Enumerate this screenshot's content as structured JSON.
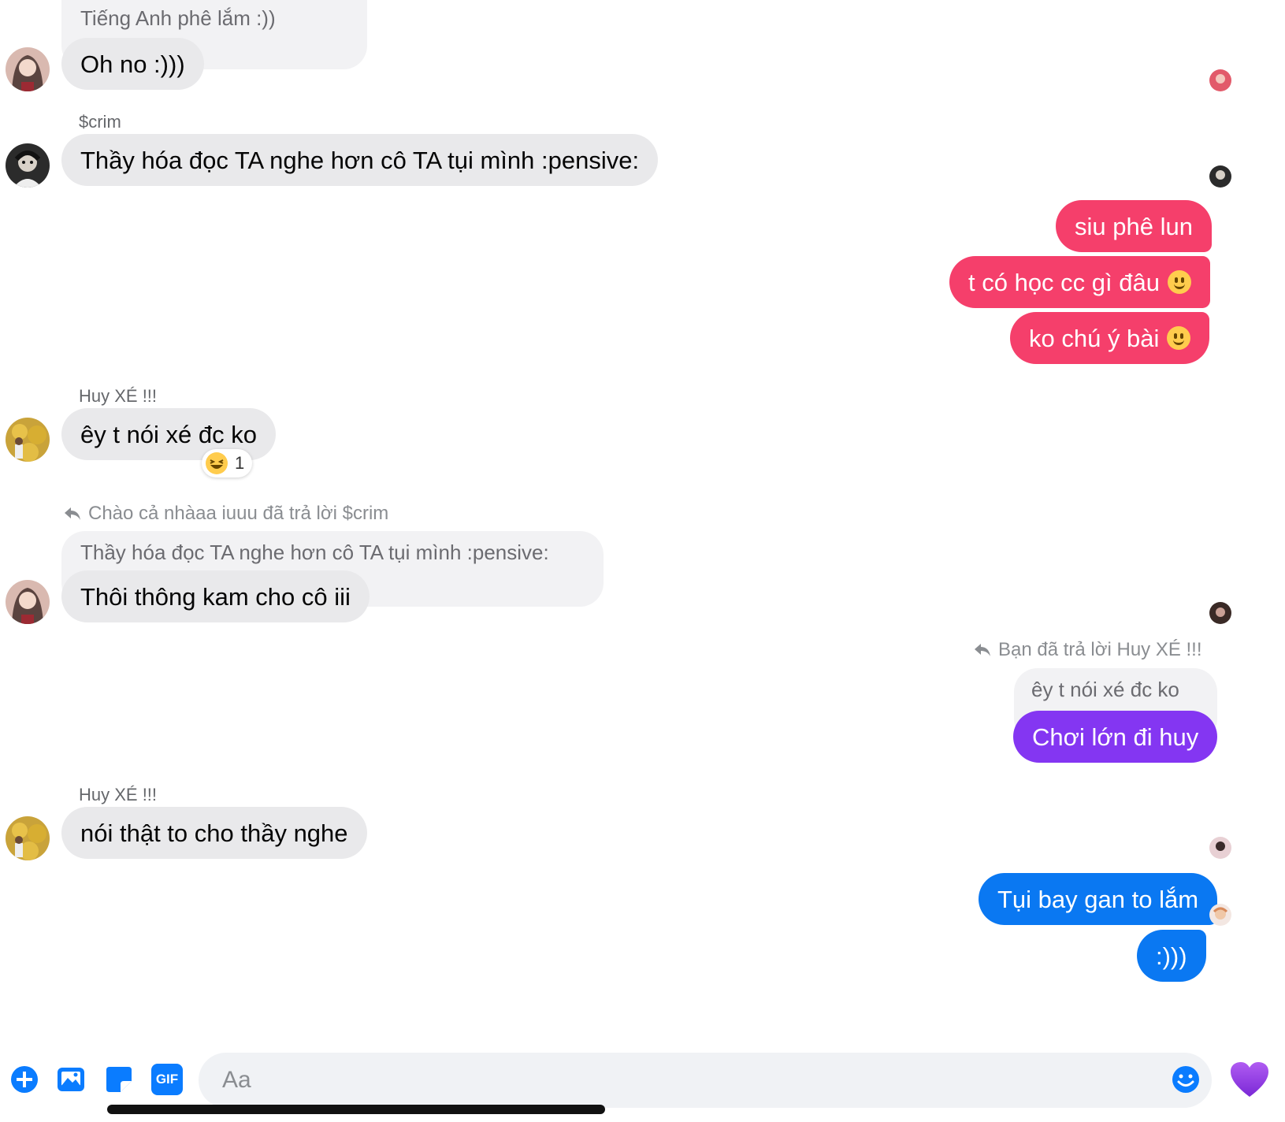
{
  "messages": {
    "m1_quote": "Tiếng Anh phê lắm :))",
    "m1_text": "Oh no :)))",
    "m2_sender": "$crim",
    "m2_text": "Thầy hóa đọc TA nghe hơn cô TA tụi mình :pensive:",
    "o1_text": "siu phê lun",
    "o2_text": "t có học cc gì đâu",
    "o3_text": "ko chú ý bài",
    "m3_sender": "Huy XÉ !!!",
    "m3_text": "êy t nói xé đc ko",
    "m3_reaction_count": "1",
    "m4_reply_meta": "Chào cả nhàaa iuuu đã trả lời $crim",
    "m4_quote": "Thầy hóa đọc TA nghe hơn cô TA tụi mình :pensive:",
    "m4_text": "Thôi thông kam cho cô iii",
    "o4_reply_meta": "Bạn đã trả lời Huy XÉ !!!",
    "o4_quote": "êy t nói xé đc ko",
    "o4_text": "Chơi lớn đi huy",
    "m5_sender": "Huy XÉ !!!",
    "m5_text": "nói thật to cho thầy nghe",
    "o5_text": "Tụi bay gan to lắm",
    "o6_text": ":)))"
  },
  "composer": {
    "placeholder": "Aa",
    "gif_label": "GIF"
  },
  "colors": {
    "incoming": "#e9e9eb",
    "outgoing_pink": "#f53f6b",
    "outgoing_purple": "#8436f2",
    "outgoing_blue": "#0a78f2",
    "accent": "#0a7cff"
  },
  "icons": [
    "plus-icon",
    "image-icon",
    "sticker-icon",
    "gif-icon",
    "emoji-icon",
    "heart-icon",
    "reply-arrow-icon",
    "laughing-emoji-icon",
    "smiley-emoji-icon"
  ]
}
